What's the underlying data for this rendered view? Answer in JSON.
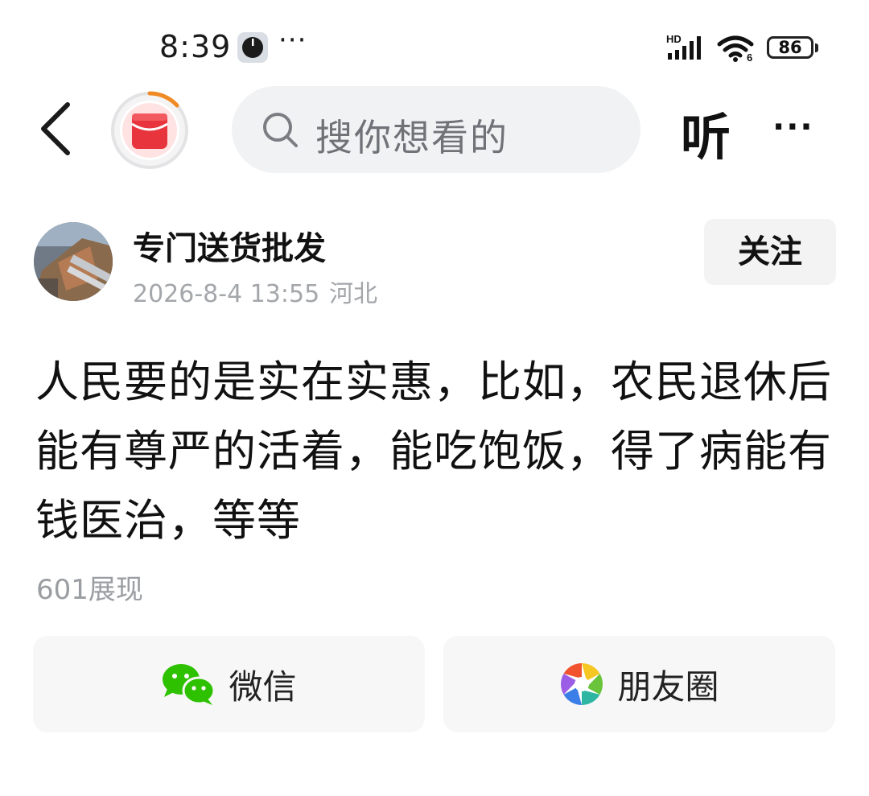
{
  "status_bar": {
    "time": "8:39",
    "more": "···",
    "network": "HD",
    "wifi_sub": "6",
    "battery": "86"
  },
  "nav": {
    "search_placeholder": "搜你想看的",
    "listen_label": "听",
    "more_label": "···"
  },
  "post": {
    "author": "专门送货批发",
    "date": "2026-8-4 13:55",
    "location": "河北",
    "follow_label": "关注",
    "content": "人民要的是实在实惠，比如，农民退休后能有尊严的活着，能吃饱饭，得了病能有钱医治，等等",
    "views": "601展现"
  },
  "share": {
    "wechat_label": "微信",
    "moments_label": "朋友圈"
  },
  "colors": {
    "accent_red": "#e8343c",
    "progress_orange": "#f08a24",
    "wechat_green": "#2dc100",
    "search_bg": "#f1f2f4"
  }
}
